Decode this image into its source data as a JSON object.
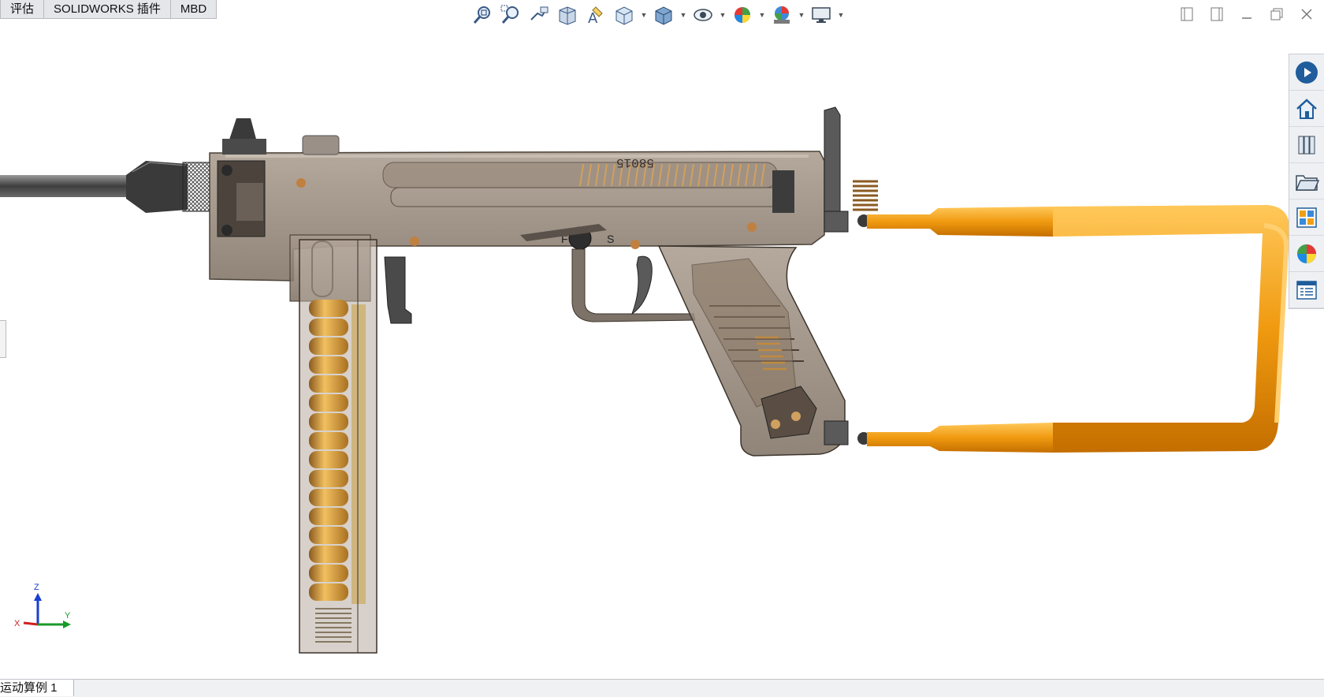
{
  "tabs": [
    {
      "label": "评估"
    },
    {
      "label": "SOLIDWORKS 插件"
    },
    {
      "label": "MBD"
    }
  ],
  "model": {
    "serial_marking": "58015",
    "selector_marks": [
      "F",
      "S"
    ]
  },
  "triad": {
    "z": "Z",
    "x": "X",
    "y": "Y"
  },
  "bottom_tab": {
    "label": "运动算例 1"
  },
  "hud_icons": [
    "zoom-to-fit-icon",
    "zoom-to-area-icon",
    "previous-view-icon",
    "section-view-icon",
    "dynamic-annotation-icon",
    "view-orientation-icon",
    "display-style-icon",
    "hide-show-items-icon",
    "edit-appearance-icon",
    "apply-scene-icon",
    "view-settings-icon"
  ],
  "taskpane_icons": [
    "solidworks-resources-icon",
    "home-icon",
    "design-library-icon",
    "file-explorer-icon",
    "view-palette-icon",
    "appearances-icon",
    "custom-properties-icon"
  ],
  "colors": {
    "stock": "#f0a018",
    "body": "#8a7a68",
    "brass": "#c8a040"
  }
}
